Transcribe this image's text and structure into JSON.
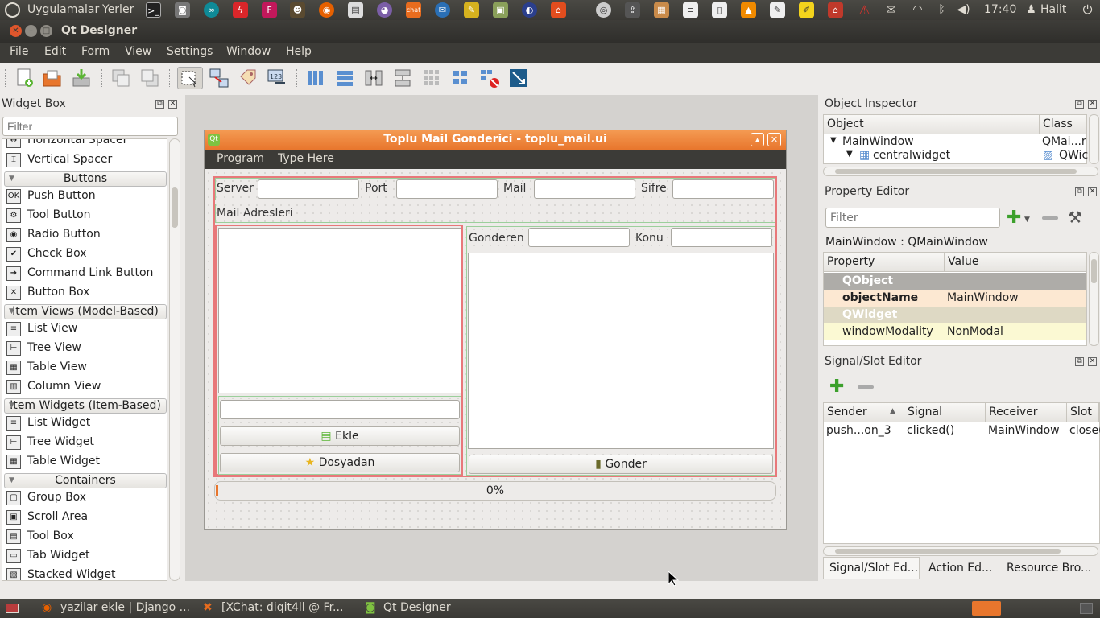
{
  "top_panel": {
    "apps_menu": "Uygulamalar",
    "places_menu": "Yerler",
    "clock": "17:40",
    "user": "Halit"
  },
  "window": {
    "title": "Qt Designer"
  },
  "menu": [
    "File",
    "Edit",
    "Form",
    "View",
    "Settings",
    "Window",
    "Help"
  ],
  "widget_box": {
    "title": "Widget Box",
    "filter_placeholder": "Filter",
    "items": [
      {
        "type": "item",
        "label": "Horizontal Spacer",
        "icon": "horizontal-spacer-icon"
      },
      {
        "type": "item",
        "label": "Vertical Spacer",
        "icon": "vertical-spacer-icon"
      },
      {
        "type": "cat",
        "label": "Buttons"
      },
      {
        "type": "item",
        "label": "Push Button",
        "icon": "push-button-icon"
      },
      {
        "type": "item",
        "label": "Tool Button",
        "icon": "tool-button-icon"
      },
      {
        "type": "item",
        "label": "Radio Button",
        "icon": "radio-button-icon"
      },
      {
        "type": "item",
        "label": "Check Box",
        "icon": "check-box-icon"
      },
      {
        "type": "item",
        "label": "Command Link Button",
        "icon": "command-link-icon"
      },
      {
        "type": "item",
        "label": "Button Box",
        "icon": "button-box-icon"
      },
      {
        "type": "cat",
        "label": "Item Views (Model-Based)"
      },
      {
        "type": "item",
        "label": "List View",
        "icon": "list-view-icon"
      },
      {
        "type": "item",
        "label": "Tree View",
        "icon": "tree-view-icon"
      },
      {
        "type": "item",
        "label": "Table View",
        "icon": "table-view-icon"
      },
      {
        "type": "item",
        "label": "Column View",
        "icon": "column-view-icon"
      },
      {
        "type": "cat",
        "label": "Item Widgets (Item-Based)"
      },
      {
        "type": "item",
        "label": "List Widget",
        "icon": "list-widget-icon"
      },
      {
        "type": "item",
        "label": "Tree Widget",
        "icon": "tree-widget-icon"
      },
      {
        "type": "item",
        "label": "Table Widget",
        "icon": "table-widget-icon"
      },
      {
        "type": "cat",
        "label": "Containers"
      },
      {
        "type": "item",
        "label": "Group Box",
        "icon": "group-box-icon"
      },
      {
        "type": "item",
        "label": "Scroll Area",
        "icon": "scroll-area-icon"
      },
      {
        "type": "item",
        "label": "Tool Box",
        "icon": "tool-box-icon"
      },
      {
        "type": "item",
        "label": "Tab Widget",
        "icon": "tab-widget-icon"
      },
      {
        "type": "item",
        "label": "Stacked Widget",
        "icon": "stacked-widget-icon"
      }
    ]
  },
  "form": {
    "title": "Toplu Mail Gonderici - toplu_mail.ui",
    "menu": [
      "Program",
      "Type Here"
    ],
    "server_label": "Server",
    "port_label": "Port",
    "mail_label": "Mail",
    "sifre_label": "Sifre",
    "mail_adresleri_label": "Mail Adresleri",
    "gonderen_label": "Gonderen",
    "konu_label": "Konu",
    "ekle_button": "Ekle",
    "dosyadan_button": "Dosyadan",
    "gonder_button": "Gonder",
    "progress_text": "0%",
    "progress_value": 0
  },
  "object_inspector": {
    "title": "Object Inspector",
    "col_object": "Object",
    "col_class": "Class",
    "rows": [
      {
        "object": "MainWindow",
        "class": "QMai...r"
      },
      {
        "object": "centralwidget",
        "class": "QWic"
      }
    ]
  },
  "property_editor": {
    "title": "Property Editor",
    "filter_placeholder": "Filter",
    "context": "MainWindow : QMainWindow",
    "col_property": "Property",
    "col_value": "Value",
    "rows": [
      {
        "kind": "group",
        "name": "QObject"
      },
      {
        "kind": "prop",
        "name": "objectName",
        "value": "MainWindow",
        "bold": true
      },
      {
        "kind": "group",
        "name": "QWidget"
      },
      {
        "kind": "prop",
        "name": "windowModality",
        "value": "NonModal",
        "bold": false
      }
    ]
  },
  "signal_slot": {
    "title": "Signal/Slot Editor",
    "col_sender": "Sender",
    "col_signal": "Signal",
    "col_receiver": "Receiver",
    "col_slot": "Slot",
    "rows": [
      {
        "sender": "push...on_3",
        "signal": "clicked()",
        "receiver": "MainWindow",
        "slot": "close("
      }
    ]
  },
  "bottom_tabs": [
    "Signal/Slot Ed...",
    "Action Ed...",
    "Resource Bro..."
  ],
  "taskbar": {
    "tasks": [
      "yazilar ekle | Django ...",
      "[XChat: diqit4ll @ Fr...",
      "Qt Designer"
    ]
  },
  "colors": {
    "accent": "#e8762d",
    "layout_red": "#e8787a",
    "panel_dark": "#3c3b37"
  }
}
